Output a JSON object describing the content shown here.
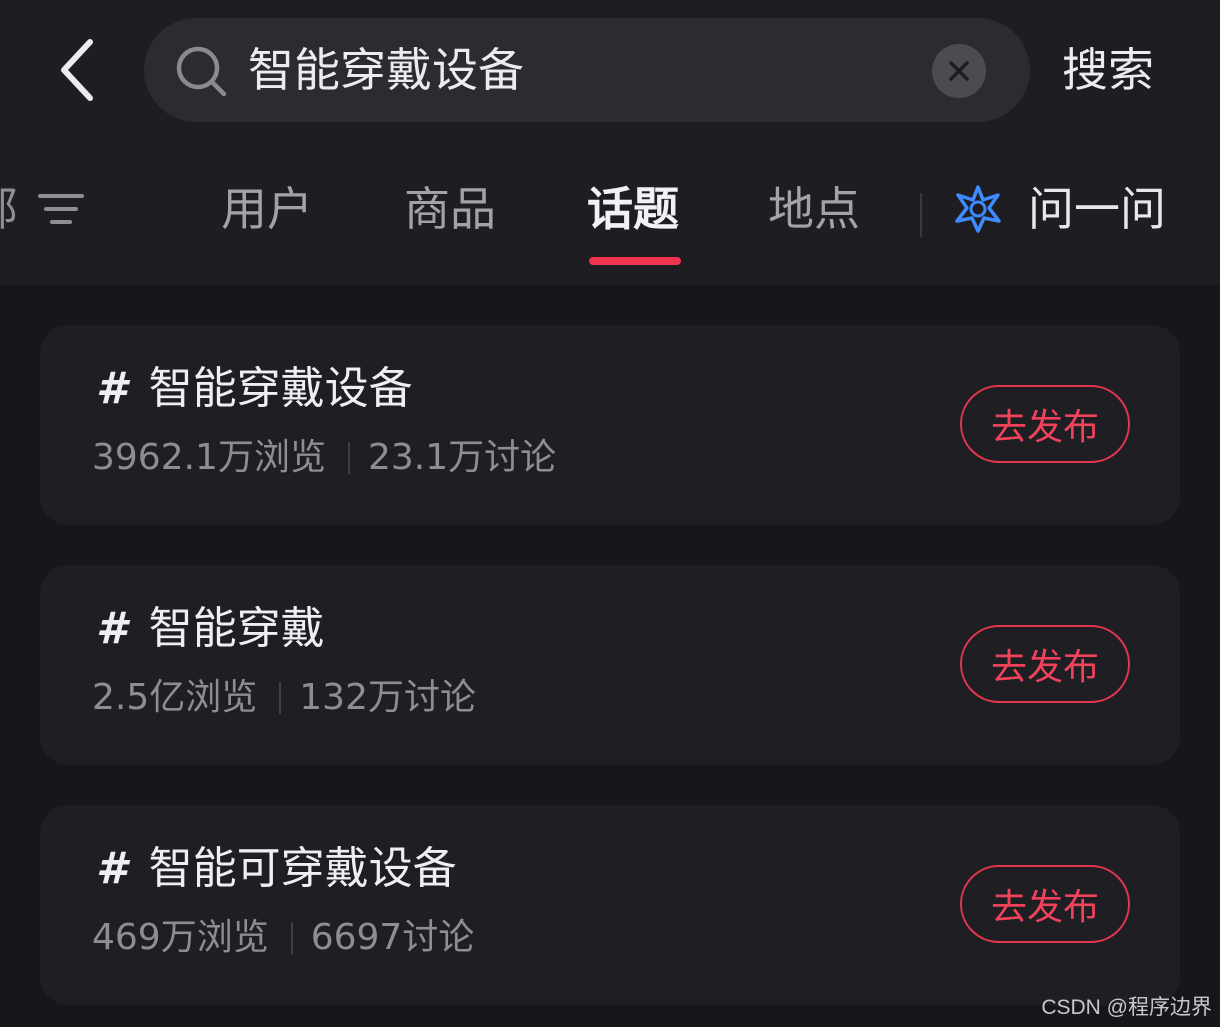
{
  "header": {
    "search": {
      "value": "智能穿戴设备"
    },
    "search_button_label": "搜索"
  },
  "tabs": {
    "all_label": "部",
    "items": [
      {
        "label": "用户"
      },
      {
        "label": "商品"
      },
      {
        "label": "话题",
        "active": true
      },
      {
        "label": "地点"
      }
    ],
    "ask_label": "问一问"
  },
  "topics": [
    {
      "title": "智能穿戴设备",
      "views": "3962.1万浏览",
      "discussions": "23.1万讨论",
      "action_label": "去发布"
    },
    {
      "title": "智能穿戴",
      "views": "2.5亿浏览",
      "discussions": "132万讨论",
      "action_label": "去发布"
    },
    {
      "title": "智能可穿戴设备",
      "views": "469万浏览",
      "discussions": "6697讨论",
      "action_label": "去发布"
    }
  ],
  "hash_symbol": "#",
  "watermark": "CSDN @程序边界",
  "icons": {
    "back": "chevron-left-icon",
    "search": "search-icon",
    "clear": "close-icon",
    "filter": "filter-icon",
    "ask": "ai-star-icon"
  },
  "colors": {
    "accent": "#f0334f",
    "background": "#16161b",
    "card": "#1e1e23",
    "ask_icon": "#3d8bff"
  }
}
